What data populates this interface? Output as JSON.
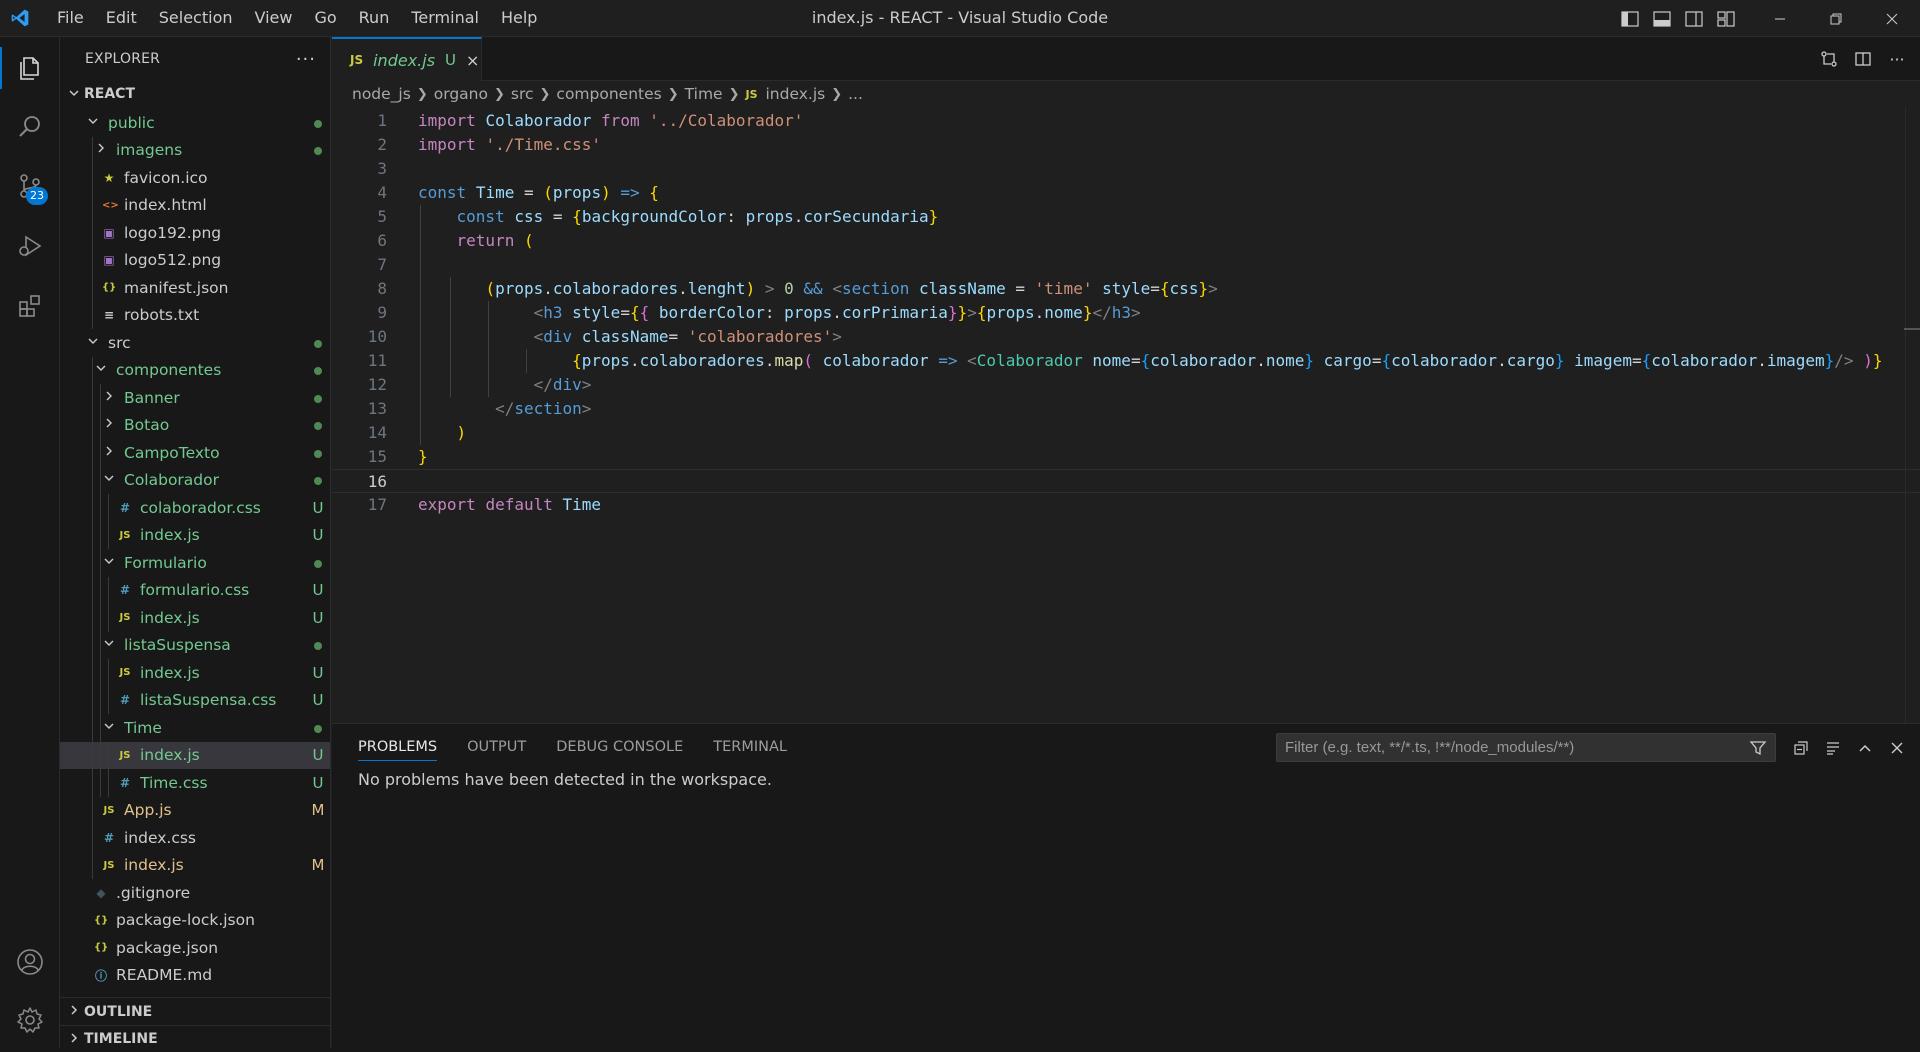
{
  "window": {
    "title": "index.js - REACT - Visual Studio Code"
  },
  "menu": [
    "File",
    "Edit",
    "Selection",
    "View",
    "Go",
    "Run",
    "Terminal",
    "Help"
  ],
  "activity": {
    "scm_badge": "23"
  },
  "sidebar": {
    "title": "EXPLORER",
    "more": "···",
    "root": "REACT",
    "tree": [
      {
        "name": "public",
        "type": "folder",
        "open": true,
        "depth": 0,
        "status": "dot",
        "color": "green"
      },
      {
        "name": "imagens",
        "type": "folder",
        "open": false,
        "depth": 1,
        "status": "dot",
        "color": "green"
      },
      {
        "name": "favicon.ico",
        "type": "star",
        "depth": 1,
        "status": "",
        "color": "plain"
      },
      {
        "name": "index.html",
        "type": "html",
        "depth": 1,
        "status": "",
        "color": "plain"
      },
      {
        "name": "logo192.png",
        "type": "img",
        "depth": 1,
        "status": "",
        "color": "plain"
      },
      {
        "name": "logo512.png",
        "type": "img",
        "depth": 1,
        "status": "",
        "color": "plain"
      },
      {
        "name": "manifest.json",
        "type": "json",
        "depth": 1,
        "status": "",
        "color": "plain"
      },
      {
        "name": "robots.txt",
        "type": "txt",
        "depth": 1,
        "status": "",
        "color": "plain"
      },
      {
        "name": "src",
        "type": "folder",
        "open": true,
        "depth": 0,
        "status": "dot",
        "color": "plain"
      },
      {
        "name": "componentes",
        "type": "folder",
        "open": true,
        "depth": 1,
        "status": "dot",
        "color": "green"
      },
      {
        "name": "Banner",
        "type": "folder",
        "open": false,
        "depth": 2,
        "status": "dot",
        "color": "green"
      },
      {
        "name": "Botao",
        "type": "folder",
        "open": false,
        "depth": 2,
        "status": "dot",
        "color": "green"
      },
      {
        "name": "CampoTexto",
        "type": "folder",
        "open": false,
        "depth": 2,
        "status": "dot",
        "color": "green"
      },
      {
        "name": "Colaborador",
        "type": "folder",
        "open": true,
        "depth": 2,
        "status": "dot",
        "color": "green"
      },
      {
        "name": "colaborador.css",
        "type": "css",
        "depth": 3,
        "status": "U",
        "color": "green"
      },
      {
        "name": "index.js",
        "type": "js",
        "depth": 3,
        "status": "U",
        "color": "green"
      },
      {
        "name": "Formulario",
        "type": "folder",
        "open": true,
        "depth": 2,
        "status": "dot",
        "color": "green"
      },
      {
        "name": "formulario.css",
        "type": "css",
        "depth": 3,
        "status": "U",
        "color": "green"
      },
      {
        "name": "index.js",
        "type": "js",
        "depth": 3,
        "status": "U",
        "color": "green"
      },
      {
        "name": "listaSuspensa",
        "type": "folder",
        "open": true,
        "depth": 2,
        "status": "dot",
        "color": "green"
      },
      {
        "name": "index.js",
        "type": "js",
        "depth": 3,
        "status": "U",
        "color": "green"
      },
      {
        "name": "listaSuspensa.css",
        "type": "css",
        "depth": 3,
        "status": "U",
        "color": "green"
      },
      {
        "name": "Time",
        "type": "folder",
        "open": true,
        "depth": 2,
        "status": "dot",
        "color": "green"
      },
      {
        "name": "index.js",
        "type": "js",
        "depth": 3,
        "status": "U",
        "color": "green",
        "selected": true
      },
      {
        "name": "Time.css",
        "type": "css",
        "depth": 3,
        "status": "U",
        "color": "green"
      },
      {
        "name": "App.js",
        "type": "js",
        "depth": 1,
        "status": "M",
        "color": "mod"
      },
      {
        "name": "index.css",
        "type": "css",
        "depth": 1,
        "status": "",
        "color": "plain"
      },
      {
        "name": "index.js",
        "type": "js",
        "depth": 1,
        "status": "M",
        "color": "mod"
      },
      {
        "name": ".gitignore",
        "type": "git",
        "depth": 0,
        "status": "",
        "color": "plain"
      },
      {
        "name": "package-lock.json",
        "type": "json",
        "depth": 0,
        "status": "",
        "color": "plain"
      },
      {
        "name": "package.json",
        "type": "json",
        "depth": 0,
        "status": "",
        "color": "plain"
      },
      {
        "name": "README.md",
        "type": "info",
        "depth": 0,
        "status": "",
        "color": "plain"
      }
    ],
    "outline": "OUTLINE",
    "timeline": "TIMELINE"
  },
  "editor": {
    "tab": {
      "icon": "JS",
      "label": "index.js",
      "status": "U",
      "close": "×"
    },
    "breadcrumbs": [
      "node_js",
      "organo",
      "src",
      "componentes",
      "Time",
      "index.js",
      "..."
    ],
    "lines": [
      "import Colaborador from '../Colaborador'",
      "import './Time.css'",
      "",
      "const Time = (props) => {",
      "    const css = {backgroundColor: props.corSecundaria}",
      "    return (",
      "",
      "       (props.colaboradores.lenght) > 0 && <section className = 'time' style={css}>",
      "            <h3 style={{ borderColor: props.corPrimaria}}>{props.nome}</h3>",
      "            <div className= 'colaboradores'>",
      "                {props.colaboradores.map( colaborador => <Colaborador nome={colaborador.nome} cargo={colaborador.cargo} imagem={colaborador.imagem}/> )}",
      "            </div>",
      "        </section>",
      "    )",
      "}",
      "",
      "export default Time"
    ],
    "current_line": 16
  },
  "panel": {
    "tabs": [
      "PROBLEMS",
      "OUTPUT",
      "DEBUG CONSOLE",
      "TERMINAL"
    ],
    "active_tab": "PROBLEMS",
    "filter_placeholder": "Filter (e.g. text, **/*.ts, !**/node_modules/**)",
    "message": "No problems have been detected in the workspace."
  },
  "colors": {
    "accent": "#0078d4",
    "untracked": "#73c991",
    "modified": "#e2c08d",
    "js_icon": "#cbcb41",
    "css_icon": "#519aba"
  }
}
